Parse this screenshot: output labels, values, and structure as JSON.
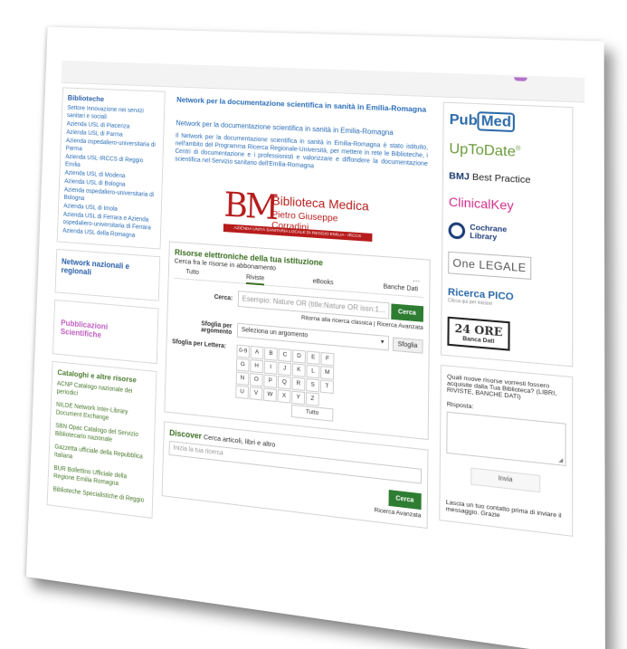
{
  "left": {
    "biblioteche_title": "Biblioteche",
    "biblioteche_links": [
      "Settore Innovazione nei servizi sanitari e sociali",
      "Azienda USL di Piacenza",
      "Azienda USL di Parma",
      "Azienda ospedaliero-universitaria di Parma",
      "Azienda USL-IRCCS di Reggio Emilia",
      "Azienda USL di Modena",
      "Azienda USL di Bologna",
      "Azienda ospedaliero-universitaria di Bologna",
      "Azienda USL di Imola",
      "Azienda USL di Ferrara e Azienda ospedaliero-universitaria di Ferrara",
      "Azienda USL della Romagna"
    ],
    "network_title": "Network nazionali e regionali",
    "pubblicazioni_title": "Pubblicazioni Scientifiche",
    "cataloghi_title": "Cataloghi e altre risorse",
    "cataloghi_links": [
      "ACNP Catalogo nazionale dei periodici",
      "NILDE Network Inter-Library Document Exchange",
      "SBN Opac Catalogo del Servizio Bibliotecario nazionale",
      "Gazzetta ufficiale della Repubblica Italiana",
      "BUR Bollettino Ufficiale della Regione Emilia Romagna",
      "Biblioteche Specialistiche di Reggio"
    ]
  },
  "main": {
    "title": "Network per la documentazione scientifica in sanità in Emilia-Romagna",
    "intro_title": "Network per la documentazione scientifica in sanità in Emilia-Romagna",
    "intro_text": "Il Network per la documentazione scientifica in sanità in Emilia-Romagna è stato istituito, nell'ambito del Programma Ricerca Regionale-Università, per mettere in rete le Biblioteche, i Centri di documentazione e i professionisti e valorizzare e diffondere la documentazione scientifica nel Servizio sanitario dell'Emilia-Romagna",
    "logo": {
      "mark": "BM",
      "line1": "Biblioteca Medica",
      "line2": "Pietro Giuseppe Corradini",
      "bar": "AZIENDA UNITÀ SANITARIA LOCALE DI REGGIO EMILIA - IRCCS"
    },
    "risorse": {
      "title": "Risorse elettroniche della tua istituzione",
      "subtitle": "Cerca fra le risorse in abbonamento",
      "tabs": [
        "Tutto",
        "Riviste",
        "eBooks",
        "Banche Dati"
      ],
      "active_tab": "Riviste",
      "more": "···",
      "cerca_label": "Cerca:",
      "search_placeholder": "Esempio: Nature OR (title:Nature OR issn:1...",
      "cerca_button": "Cerca",
      "links": "Ritorna alla ricerca classica | Ricerca Avanzata",
      "sfoglia_label": "Sfoglia per argomento",
      "select_value": "Seleziona un argomento",
      "sfoglia_button": "Sfoglia",
      "letters_label": "Sfoglia per Lettera:",
      "letters": [
        "0-9",
        "A",
        "B",
        "C",
        "D",
        "E",
        "F",
        "G",
        "H",
        "I",
        "J",
        "K",
        "L",
        "M",
        "N",
        "O",
        "P",
        "Q",
        "R",
        "S",
        "T",
        "U",
        "V",
        "W",
        "X",
        "Y",
        "Z"
      ],
      "tutto": "Tutto"
    },
    "discover": {
      "title": "Discover",
      "subtitle": "Cerca articoli, libri e altro",
      "placeholder": "Inizia la tua ricerca",
      "button": "Cerca",
      "advanced": "Ricerca Avanzata"
    }
  },
  "right": {
    "resources": {
      "pubmed_a": "Pub",
      "pubmed_b": "Med",
      "uptodate": "UpToDate",
      "uptodate_mark": "®",
      "bmj_a": "BMJ",
      "bmj_b": "Best Practice",
      "clinicalkey": "ClinicalKey",
      "cochrane_a": "Cochrane",
      "cochrane_b": "Library",
      "onelegale": "One LEGALE",
      "pico": "Ricerca PICO",
      "pico_sub": "Clicca qui per iniziare",
      "ore_big": "24 ORE",
      "ore_small": "Banca Dati"
    },
    "survey": {
      "question": "Quali nuove risorse vorresti fossero acquisite dalla Tua Biblioteca? (LIBRI, RIVISTE, BANCHE DATI)",
      "risposta_label": "Risposta:",
      "invia": "Invia",
      "note": "Lascia un tuo contatto prima di inviare il messaggio. Grazie"
    }
  }
}
